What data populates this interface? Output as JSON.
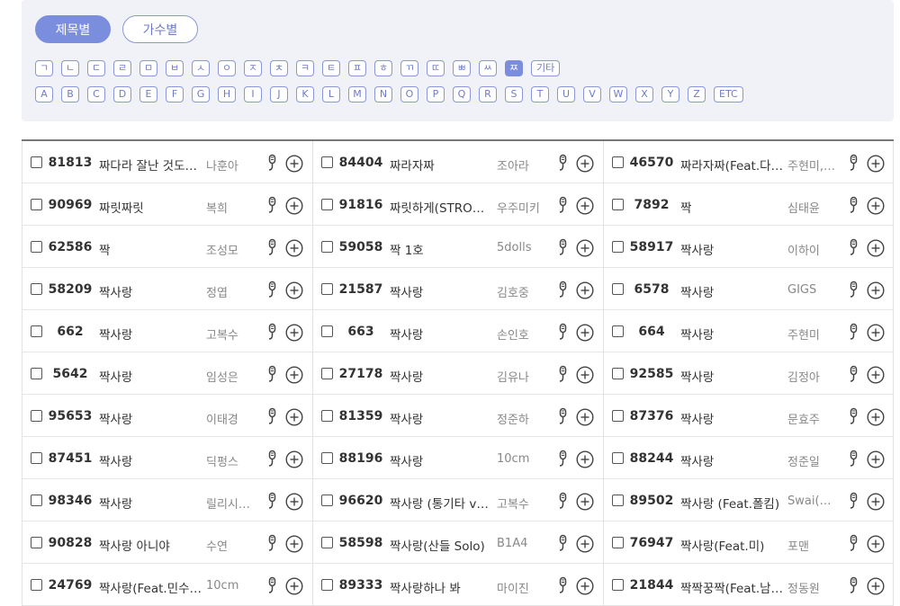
{
  "tabs": [
    {
      "label": "제목별",
      "active": true
    },
    {
      "label": "가수별",
      "active": false
    }
  ],
  "letters_row1": [
    {
      "label": "ㄱ"
    },
    {
      "label": "ㄴ"
    },
    {
      "label": "ㄷ"
    },
    {
      "label": "ㄹ"
    },
    {
      "label": "ㅁ"
    },
    {
      "label": "ㅂ"
    },
    {
      "label": "ㅅ"
    },
    {
      "label": "ㅇ"
    },
    {
      "label": "ㅈ"
    },
    {
      "label": "ㅊ"
    },
    {
      "label": "ㅋ"
    },
    {
      "label": "ㅌ"
    },
    {
      "label": "ㅍ"
    },
    {
      "label": "ㅎ"
    },
    {
      "label": "ㄲ"
    },
    {
      "label": "ㄸ"
    },
    {
      "label": "ㅃ"
    },
    {
      "label": "ㅆ"
    },
    {
      "label": "ㅉ",
      "active": true
    },
    {
      "label": "기타"
    }
  ],
  "letters_row2": [
    {
      "label": "A"
    },
    {
      "label": "B"
    },
    {
      "label": "C"
    },
    {
      "label": "D"
    },
    {
      "label": "E"
    },
    {
      "label": "F"
    },
    {
      "label": "G"
    },
    {
      "label": "H"
    },
    {
      "label": "I"
    },
    {
      "label": "J"
    },
    {
      "label": "K"
    },
    {
      "label": "L"
    },
    {
      "label": "M"
    },
    {
      "label": "N"
    },
    {
      "label": "O"
    },
    {
      "label": "P"
    },
    {
      "label": "Q"
    },
    {
      "label": "R"
    },
    {
      "label": "S"
    },
    {
      "label": "T"
    },
    {
      "label": "U"
    },
    {
      "label": "V"
    },
    {
      "label": "W"
    },
    {
      "label": "X"
    },
    {
      "label": "Y"
    },
    {
      "label": "Z"
    },
    {
      "label": "ETC"
    }
  ],
  "accent_color": "#7b8ede",
  "songs": [
    [
      {
        "num": "81813",
        "title": "짜다라 잘난 것도…",
        "artist": "나훈아"
      },
      {
        "num": "90969",
        "title": "짜릿짜릿",
        "artist": "복희"
      },
      {
        "num": "62586",
        "title": "짝",
        "artist": "조성모"
      },
      {
        "num": "58209",
        "title": "짝사랑",
        "artist": "정엽"
      },
      {
        "num": "662",
        "title": "짝사랑",
        "artist": "고복수"
      },
      {
        "num": "5642",
        "title": "짝사랑",
        "artist": "임성은"
      },
      {
        "num": "95653",
        "title": "짝사랑",
        "artist": "이태경"
      },
      {
        "num": "87451",
        "title": "짝사랑",
        "artist": "딕펑스"
      },
      {
        "num": "98346",
        "title": "짝사랑",
        "artist": "릴리시…"
      },
      {
        "num": "90828",
        "title": "짝사랑 아니야",
        "artist": "수연"
      },
      {
        "num": "24769",
        "title": "짝사랑(Feat.민수…",
        "artist": "10cm"
      }
    ],
    [
      {
        "num": "84404",
        "title": "짜라자짜",
        "artist": "조아라"
      },
      {
        "num": "91816",
        "title": "짜릿하게(STRO…",
        "artist": "우주미키"
      },
      {
        "num": "59058",
        "title": "짝 1호",
        "artist": "5dolls"
      },
      {
        "num": "21587",
        "title": "짝사랑",
        "artist": "김호중"
      },
      {
        "num": "663",
        "title": "짝사랑",
        "artist": "손인호"
      },
      {
        "num": "27178",
        "title": "짝사랑",
        "artist": "김유나"
      },
      {
        "num": "81359",
        "title": "짝사랑",
        "artist": "정준하"
      },
      {
        "num": "88196",
        "title": "짝사랑",
        "artist": "10cm"
      },
      {
        "num": "96620",
        "title": "짝사랑 (통기타 v…",
        "artist": "고복수"
      },
      {
        "num": "58598",
        "title": "짝사랑(산들 Solo)",
        "artist": "B1A4"
      },
      {
        "num": "89333",
        "title": "짝사랑하나 봐",
        "artist": "마이진"
      }
    ],
    [
      {
        "num": "46570",
        "title": "짜라자짜(Feat.다…",
        "artist": "주현미,…"
      },
      {
        "num": "7892",
        "title": "짝",
        "artist": "심태윤"
      },
      {
        "num": "58917",
        "title": "짝사랑",
        "artist": "이하이"
      },
      {
        "num": "6578",
        "title": "짝사랑",
        "artist": "GIGS"
      },
      {
        "num": "664",
        "title": "짝사랑",
        "artist": "주현미"
      },
      {
        "num": "92585",
        "title": "짝사랑",
        "artist": "김정아"
      },
      {
        "num": "87376",
        "title": "짝사랑",
        "artist": "문효주"
      },
      {
        "num": "88244",
        "title": "짝사랑",
        "artist": "정준일"
      },
      {
        "num": "89502",
        "title": "짝사랑 (Feat.폴킴)",
        "artist": "Swai(…"
      },
      {
        "num": "76947",
        "title": "짝사랑(Feat.미)",
        "artist": "포맨"
      },
      {
        "num": "21844",
        "title": "짝짝꿍짝(Feat.남…",
        "artist": "정동원"
      }
    ]
  ]
}
